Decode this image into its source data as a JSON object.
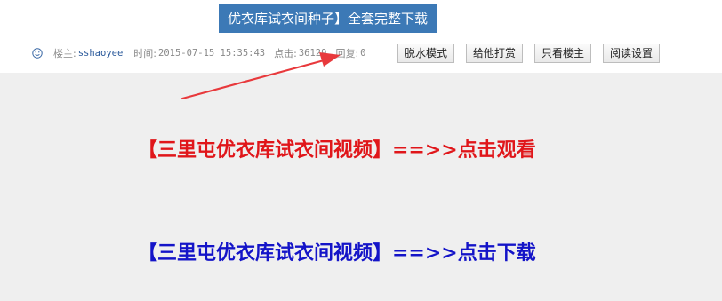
{
  "title": "优衣库试衣间种子】全套完整下载",
  "meta": {
    "author_label": "楼主:",
    "author": "sshaoyee",
    "time_label": "时间:",
    "time": "2015-07-15 15:35:43",
    "clicks_label": "点击:",
    "clicks": "36129",
    "replies_label": "回复:",
    "replies": "0"
  },
  "buttons": {
    "plain_mode": "脱水模式",
    "tip": "给他打赏",
    "only_op": "只看楼主",
    "read_settings": "阅读设置"
  },
  "links": {
    "watch": "【三里屯优衣库试衣间视频】==>>点击观看",
    "download": "【三里屯优衣库试衣间视频】==>>点击下载"
  },
  "colors": {
    "title_bg": "#3c79b6",
    "watch_link": "#e0161a",
    "download_link": "#1414c8",
    "arrow": "#e8393c",
    "content_bg": "#efefef"
  }
}
